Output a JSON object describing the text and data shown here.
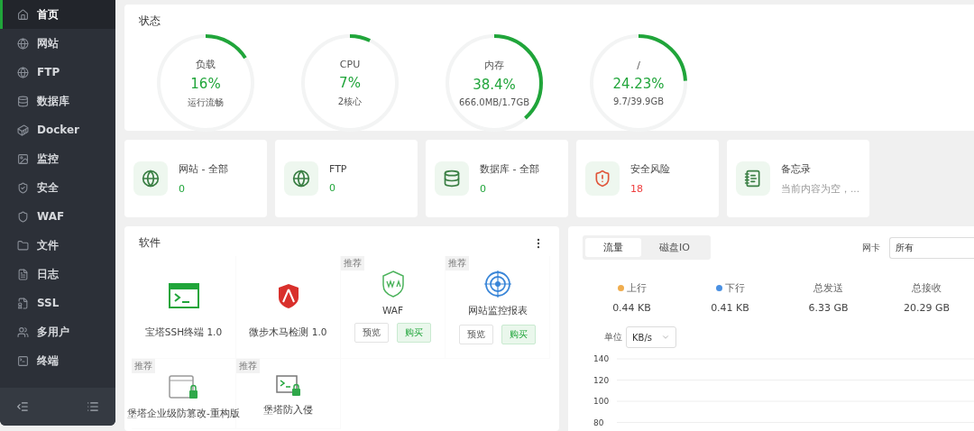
{
  "sidebar": {
    "items": [
      {
        "label": "首页",
        "selected": true
      },
      {
        "label": "网站",
        "selected": false
      },
      {
        "label": "FTP",
        "selected": false
      },
      {
        "label": "数据库",
        "selected": false
      },
      {
        "label": "Docker",
        "selected": false
      },
      {
        "label": "监控",
        "selected": false
      },
      {
        "label": "安全",
        "selected": false
      },
      {
        "label": "WAF",
        "selected": false
      },
      {
        "label": "文件",
        "selected": false
      },
      {
        "label": "日志",
        "selected": false
      },
      {
        "label": "SSL",
        "selected": false
      },
      {
        "label": "多用户",
        "selected": false
      },
      {
        "label": "终端",
        "selected": false
      }
    ]
  },
  "status": {
    "title": "状态",
    "gauges": [
      {
        "label": "负载",
        "value": "16%",
        "detail": "运行流畅",
        "level": 0.16
      },
      {
        "label": "CPU",
        "value": "7%",
        "detail": "2核心",
        "level": 0.07
      },
      {
        "label": "内存",
        "value": "38.4%",
        "detail": "666.0MB/1.7GB",
        "level": 0.384
      },
      {
        "label": "/",
        "value": "24.23%",
        "detail": "9.7/39.9GB",
        "level": 0.2423
      }
    ]
  },
  "overview": [
    {
      "kind": "count",
      "title": "网站 - 全部",
      "value": "0",
      "color": "#20a53a"
    },
    {
      "kind": "count",
      "title": "FTP",
      "value": "0",
      "color": "#20a53a"
    },
    {
      "kind": "count",
      "title": "数据库 - 全部",
      "value": "0",
      "color": "#20a53a"
    },
    {
      "kind": "count",
      "title": "安全风险",
      "value": "18",
      "color": "#ef3d3d"
    },
    {
      "kind": "note",
      "title": "备忘录",
      "value": "当前内容为空，..."
    }
  ],
  "software": {
    "title": "软件",
    "items": [
      {
        "kind": "terminal",
        "name": "宝塔SSH终端 1.0"
      },
      {
        "kind": "shield",
        "name": "微步木马检测 1.0"
      },
      {
        "kind": "waf",
        "name": "WAF",
        "tag": "推荐",
        "buttons": [
          "预览",
          "购买"
        ]
      },
      {
        "kind": "radar",
        "name": "网站监控报表",
        "tag": "推荐",
        "buttons": [
          "预览",
          "购买"
        ]
      },
      {
        "kind": "browser",
        "name": "堡塔企业级防篡改-重构版",
        "tag": "推荐"
      },
      {
        "kind": "console",
        "name": "堡塔防入侵",
        "tag": "推荐"
      }
    ]
  },
  "traffic": {
    "tabs": [
      {
        "label": "流量",
        "selected": true
      },
      {
        "label": "磁盘IO",
        "selected": false
      }
    ],
    "nic_label": "网卡",
    "nic_value": "所有",
    "stats": [
      {
        "label": "上行",
        "value": "0.44 KB",
        "color": "#f0ad4e"
      },
      {
        "label": "下行",
        "value": "0.41 KB",
        "color": "#4a90e2"
      },
      {
        "label": "总发送",
        "value": "6.33 GB"
      },
      {
        "label": "总接收",
        "value": "20.29 GB"
      }
    ],
    "unit_label": "单位",
    "unit_value": "KB/s",
    "chart_y_labels": [
      "140",
      "120",
      "100",
      "80"
    ]
  }
}
